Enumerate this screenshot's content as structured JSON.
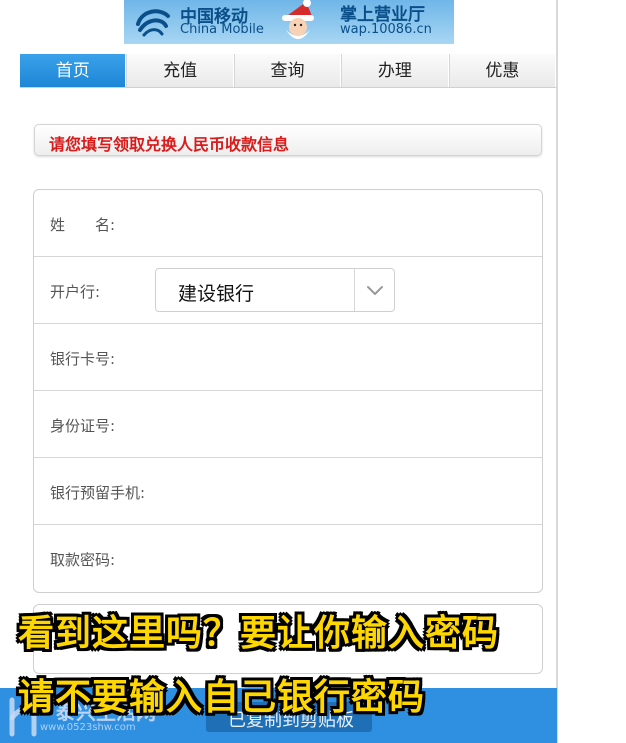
{
  "banner": {
    "brand_cn": "中国移动",
    "brand_en": "China Mobile",
    "hall_title": "掌上营业厅",
    "site_url": "wap.10086.cn"
  },
  "nav": {
    "items": [
      {
        "label": "首页",
        "active": true
      },
      {
        "label": "充值",
        "active": false
      },
      {
        "label": "查询",
        "active": false
      },
      {
        "label": "办理",
        "active": false
      },
      {
        "label": "优惠",
        "active": false
      }
    ]
  },
  "notice": {
    "text": "请您填写领取兑换人民币收款信息"
  },
  "form": {
    "name_label": "姓　　名:",
    "bank_label": "开户行:",
    "bank_selected": "建设银行",
    "card_label": "银行卡号:",
    "id_label": "身份证号:",
    "phone_label": "银行预留手机:",
    "password_label": "取款密码:"
  },
  "bottom": {
    "button_label": "已复制到剪贴板"
  },
  "captions": {
    "line1": "看到这里吗？要让你输入密码",
    "line2": "请不要输入自己银行密码"
  },
  "watermark": {
    "text": "泰兴生活网",
    "url": "www.0523shw.com"
  },
  "colors": {
    "nav_active": "#1d86d6",
    "notice_text": "#d91b1b",
    "caption": "#ffd700",
    "bottom_bar": "#2f8fe0"
  }
}
